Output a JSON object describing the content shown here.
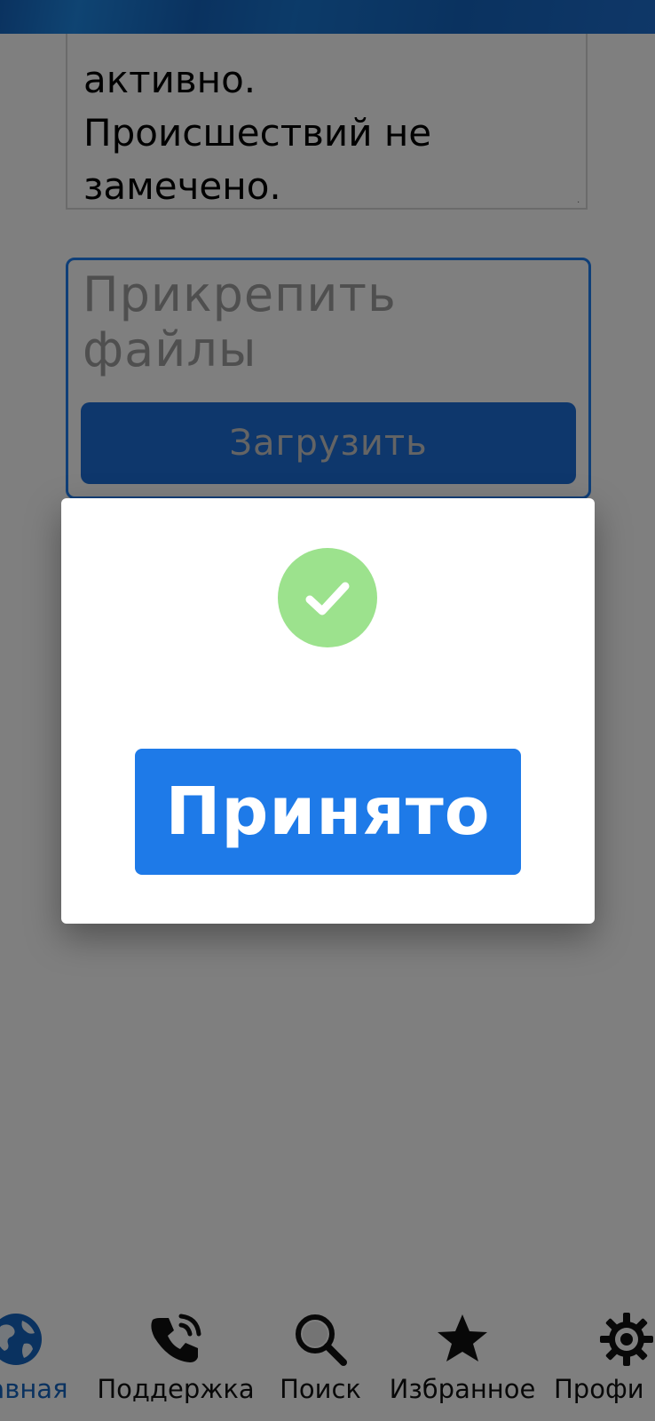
{
  "report": {
    "lines": [
      "активно.",
      "Происшествий не",
      "замечено."
    ]
  },
  "attach": {
    "label": "Прикрепить файлы",
    "upload_label": "Загрузить"
  },
  "dialog": {
    "status_icon": "check-circle-icon",
    "accept_label": "Принято",
    "icon_color": "#9ce28d",
    "button_color": "#1e7ae8"
  },
  "bottom_nav": {
    "items": [
      {
        "label": "Главная",
        "visible_text": "авная",
        "icon": "globe-icon",
        "active": true
      },
      {
        "label": "Поддержка",
        "icon": "phone-icon",
        "active": false
      },
      {
        "label": "Поиск",
        "icon": "search-icon",
        "active": false
      },
      {
        "label": "Избранное",
        "icon": "star-icon",
        "active": false
      },
      {
        "label": "Профиль",
        "visible_text": "Профи",
        "icon": "gear-icon",
        "active": false
      }
    ]
  },
  "colors": {
    "accent": "#1e7ff0",
    "header": "#1565c0",
    "active_nav": "#1565c0"
  }
}
